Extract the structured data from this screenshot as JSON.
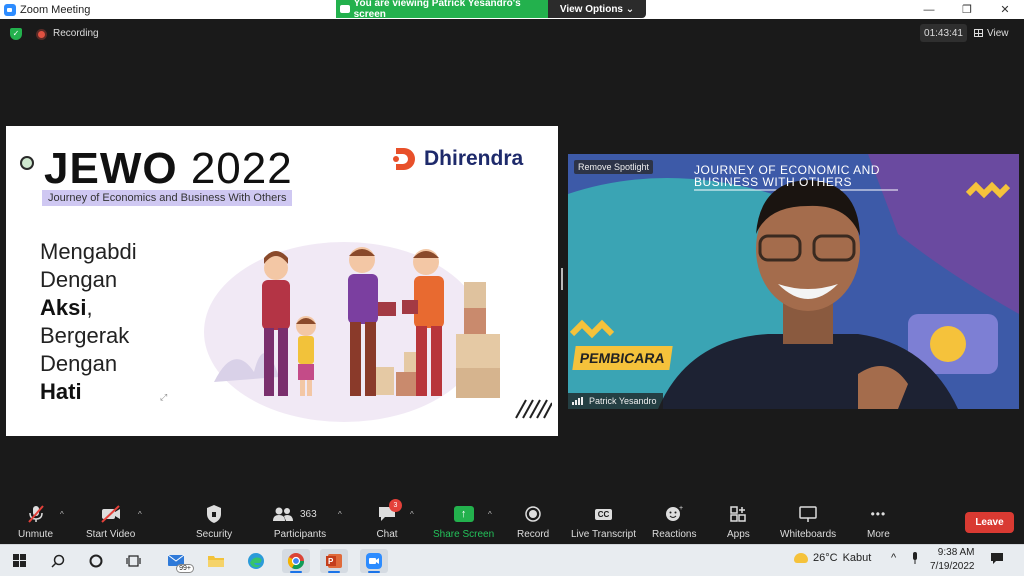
{
  "window": {
    "title": "Zoom Meeting",
    "minimize": "—",
    "restore": "❐",
    "close": "✕"
  },
  "banner": {
    "viewing_text": "You are viewing Patrick Yesandro's screen",
    "view_options": "View Options ⌄"
  },
  "meeting_bar": {
    "recording_label": "Recording",
    "timer": "01:43:41",
    "view_label": "View"
  },
  "slide": {
    "title_main": "JEWO",
    "title_year": "2022",
    "subtitle": "Journey of Economics and Business With Others",
    "brand": "Dhirendra",
    "lines": [
      "Mengabdi",
      "Dengan",
      "Aksi",
      ",",
      "Bergerak",
      "Dengan",
      "Hati"
    ]
  },
  "video": {
    "remove_spotlight": "Remove Spotlight",
    "headline_1": "JOURNEY OF ECONOMIC AND",
    "headline_2": "BUSINESS WITH OTHERS",
    "pembicara": "PEMBICARA",
    "participant_name": "Patrick Yesandro"
  },
  "toolbar": {
    "unmute": "Unmute",
    "start_video": "Start Video",
    "security": "Security",
    "participants": "Participants",
    "participants_count": "363",
    "chat": "Chat",
    "chat_badge": "3",
    "share_screen": "Share Screen",
    "record": "Record",
    "live_transcript": "Live Transcript",
    "cc": "CC",
    "reactions": "Reactions",
    "apps": "Apps",
    "whiteboards": "Whiteboards",
    "more": "More",
    "more_dots": "•••",
    "leave": "Leave"
  },
  "taskbar": {
    "badge_count": "99+",
    "weather_temp": "26°C",
    "weather_text": "Kabut",
    "time": "9:38 AM",
    "date": "7/19/2022"
  },
  "colors": {
    "share_green": "#23b14d",
    "leave_red": "#d93a32",
    "slide_purple": "#cfc8f2",
    "brand_orange": "#e8502a",
    "brand_navy": "#1e2a6b"
  }
}
